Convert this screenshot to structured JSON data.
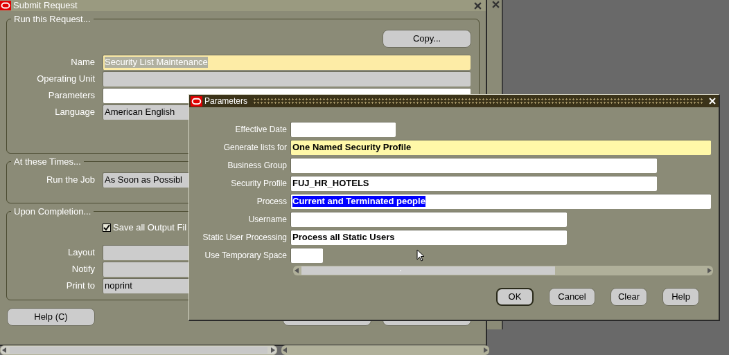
{
  "submit_window": {
    "title": "Submit Request",
    "run_group": {
      "legend": "Run this Request...",
      "copy_button": "Copy...",
      "fields": [
        {
          "label": "Name",
          "value": "Security List Maintenance",
          "kind": "required",
          "highlighted": true
        },
        {
          "label": "Operating Unit",
          "kind": "readonly"
        },
        {
          "label": "Parameters",
          "kind": "text"
        },
        {
          "label": "Language",
          "value": "American English",
          "kind": "readonly",
          "highlighted": false
        }
      ]
    },
    "times_group": {
      "legend": "At these Times...",
      "fields": [
        {
          "label": "Run the Job",
          "value": "As Soon as Possibl",
          "kind": "readonly",
          "highlighted": false
        }
      ]
    },
    "completion_group": {
      "legend": "Upon Completion...",
      "save_output": {
        "label": "Save all Output Fil",
        "checked": true
      },
      "fields": [
        {
          "label": "Layout",
          "kind": "readonly"
        },
        {
          "label": "Notify",
          "kind": "readonly"
        },
        {
          "label": "Print to",
          "value": "noprint",
          "kind": "readonly",
          "highlighted": false
        }
      ]
    },
    "help_button": "Help (C)"
  },
  "parameters_dialog": {
    "title": "Parameters",
    "fields": [
      {
        "label": "Effective Date",
        "kind": "text"
      },
      {
        "label": "Generate lists for",
        "value": "One Named Security Profile",
        "kind": "required",
        "highlighted": false
      },
      {
        "label": "Business Group",
        "kind": "text"
      },
      {
        "label": "Security Profile",
        "value": "FUJ_HR_HOTELS",
        "kind": "text",
        "highlighted": false
      },
      {
        "label": "Process",
        "value": "Current and Terminated people",
        "kind": "text",
        "highlighted": true
      },
      {
        "label": "Username",
        "kind": "text"
      },
      {
        "label": "Static User Processing",
        "value": "Process all Static Users",
        "kind": "text",
        "highlighted": false
      },
      {
        "label": "Use Temporary Space",
        "kind": "text"
      }
    ],
    "buttons": [
      {
        "label": "OK",
        "selected": true
      },
      {
        "label": "Cancel",
        "selected": false
      },
      {
        "label": "Clear",
        "selected": false
      },
      {
        "label": "Help",
        "selected": false
      }
    ]
  }
}
